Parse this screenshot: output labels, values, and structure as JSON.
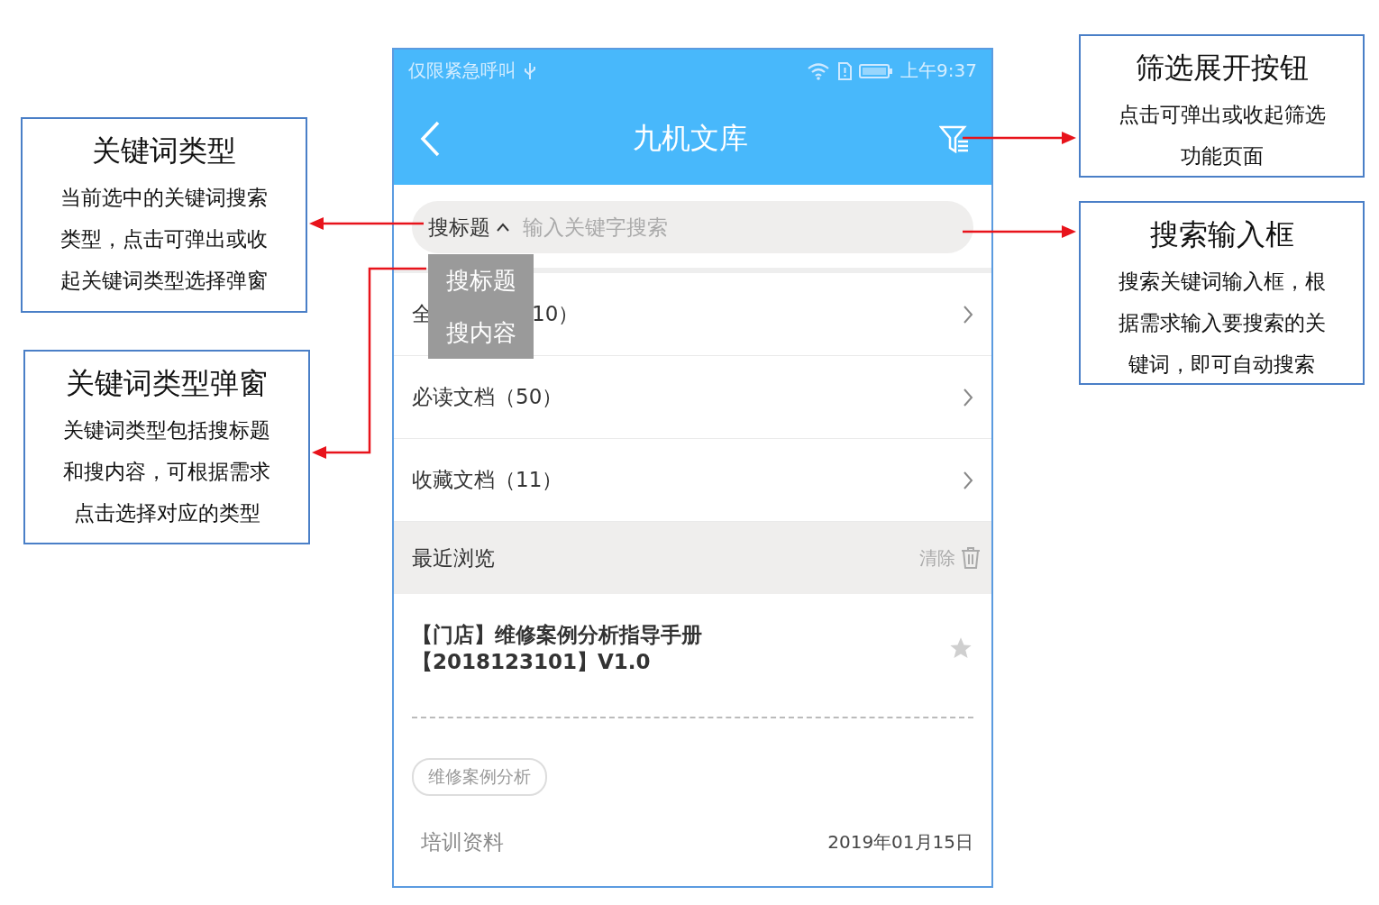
{
  "status_bar": {
    "carrier": "仅限紧急呼叫",
    "time": "上午9:37"
  },
  "header": {
    "title": "九机文库"
  },
  "search": {
    "type_label": "搜标题",
    "placeholder": "输入关键字搜索"
  },
  "type_menu": {
    "items": [
      {
        "label": "搜标题"
      },
      {
        "label": "搜内容"
      }
    ]
  },
  "categories": [
    {
      "label_parts": [
        "全",
        "10）"
      ]
    },
    {
      "label_parts": [
        "必读文档（50）"
      ]
    },
    {
      "label_parts": [
        "收藏文档（11）"
      ]
    }
  ],
  "recent": {
    "title": "最近浏览",
    "clear": "清除"
  },
  "document": {
    "title_lines": [
      "【门店】维修案例分析指导手册",
      "【2018123101】V1.0"
    ],
    "starred": false,
    "tag": "维修案例分析",
    "category": "培训资料",
    "date": "2019年01月15日"
  },
  "callouts": [
    {
      "title": "关键词类型",
      "lines": [
        "当前选中的关键词搜索",
        "类型，点击可弹出或收",
        "起关键词类型选择弹窗"
      ]
    },
    {
      "title": "关键词类型弹窗",
      "lines": [
        "关键词类型包括搜标题",
        "和搜内容，可根据需求",
        "点击选择对应的类型"
      ]
    },
    {
      "title": "筛选展开按钮",
      "lines": [
        "点击可弹出或收起筛选",
        "功能页面"
      ]
    },
    {
      "title": "搜索输入框",
      "lines": [
        "搜索关键词输入框，根",
        "据需求输入要搜索的关",
        "键词，即可自动搜索"
      ]
    }
  ]
}
